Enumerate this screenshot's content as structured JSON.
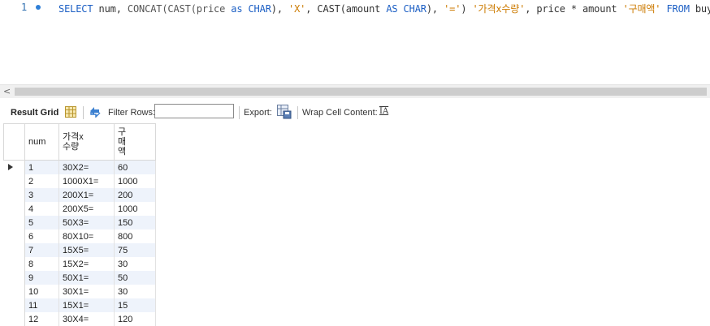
{
  "editor": {
    "line_number": "1",
    "code": {
      "t1": "SELECT",
      "t2": " num, ",
      "t3": "CONCAT(CAST(price ",
      "t4": "as",
      "t5": " ",
      "t6": "CHAR",
      "t7": "), ",
      "t8": "'X'",
      "t9": ", CAST(amount ",
      "t10": "AS",
      "t11": " ",
      "t12": "CHAR",
      "t13": "), ",
      "t14": "'='",
      "t15": ") ",
      "t16": "'가격x수량'",
      "t17": ", price * amount ",
      "t18": "'구매액'",
      "t19": " ",
      "t20": "FROM",
      "t21": " buy;"
    }
  },
  "scrollbar": {
    "left_arrow": "<"
  },
  "toolbar": {
    "result_grid": "Result Grid",
    "filter_rows": "Filter Rows:",
    "filter_value": "",
    "export": "Export:",
    "wrap_cell": "Wrap Cell Content:",
    "wrap_icon": "IA"
  },
  "grid": {
    "columns": [
      "num",
      "가격x수량",
      "구매액"
    ],
    "rows": [
      [
        "1",
        "30X2=",
        "60"
      ],
      [
        "2",
        "1000X1=",
        "1000"
      ],
      [
        "3",
        "200X1=",
        "200"
      ],
      [
        "4",
        "200X5=",
        "1000"
      ],
      [
        "5",
        "50X3=",
        "150"
      ],
      [
        "6",
        "80X10=",
        "800"
      ],
      [
        "7",
        "15X5=",
        "75"
      ],
      [
        "8",
        "15X2=",
        "30"
      ],
      [
        "9",
        "50X1=",
        "50"
      ],
      [
        "10",
        "30X1=",
        "30"
      ],
      [
        "11",
        "15X1=",
        "15"
      ],
      [
        "12",
        "30X4=",
        "120"
      ]
    ]
  },
  "colors": {
    "keyword": "#1c5fc4",
    "string": "#cc7a00",
    "row_alt": "#eef3fb"
  }
}
